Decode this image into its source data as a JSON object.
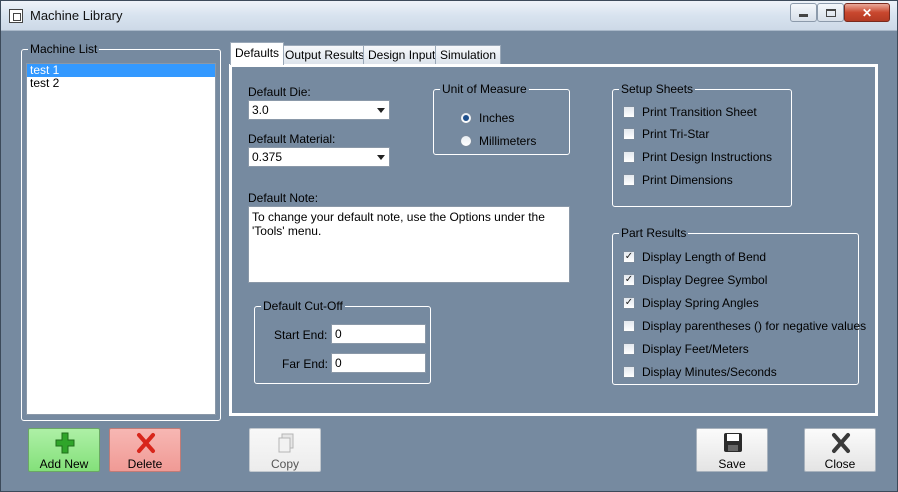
{
  "window": {
    "title": "Machine Library",
    "controls": {
      "minimize": "minimize-icon",
      "maximize": "maximize-icon",
      "close": "✕"
    }
  },
  "machine_list": {
    "title": "Machine List",
    "items": [
      {
        "label": "test 1",
        "selected": true
      },
      {
        "label": "test 2",
        "selected": false
      }
    ]
  },
  "tabs": [
    {
      "label": "Defaults",
      "active": true
    },
    {
      "label": "Output Results",
      "active": false
    },
    {
      "label": "Design Input",
      "active": false
    },
    {
      "label": "Simulation",
      "active": false
    }
  ],
  "defaults": {
    "die_label": "Default Die:",
    "die_value": "3.0",
    "material_label": "Default Material:",
    "material_value": "0.375",
    "note_label": "Default Note:",
    "note_value": "To change your default note, use the Options under the 'Tools' menu.",
    "unit": {
      "title": "Unit of Measure",
      "options": [
        {
          "label": "Inches",
          "selected": true
        },
        {
          "label": "Millimeters",
          "selected": false
        }
      ]
    },
    "cutoff": {
      "title": "Default Cut-Off",
      "start_label": "Start End:",
      "start_value": "0",
      "far_label": "Far End:",
      "far_value": "0"
    },
    "setup_sheets": {
      "title": "Setup Sheets",
      "items": [
        {
          "label": "Print Transition Sheet",
          "checked": false
        },
        {
          "label": "Print Tri-Star",
          "checked": false
        },
        {
          "label": "Print Design Instructions",
          "checked": false
        },
        {
          "label": "Print Dimensions",
          "checked": false
        }
      ]
    },
    "part_results": {
      "title": "Part Results",
      "items": [
        {
          "label": "Display Length of Bend",
          "checked": true
        },
        {
          "label": "Display Degree Symbol",
          "checked": true
        },
        {
          "label": "Display Spring Angles",
          "checked": true
        },
        {
          "label": "Display parentheses () for negative values",
          "checked": false
        },
        {
          "label": "Display Feet/Meters",
          "checked": false
        },
        {
          "label": "Display Minutes/Seconds",
          "checked": false
        }
      ]
    }
  },
  "buttons": {
    "add": "Add New",
    "delete": "Delete",
    "copy": "Copy",
    "save": "Save",
    "close": "Close"
  },
  "colors": {
    "background": "#768aa0",
    "selection": "#3399ff",
    "add_button": "#8fe486",
    "delete_button": "#f3a6a1"
  }
}
